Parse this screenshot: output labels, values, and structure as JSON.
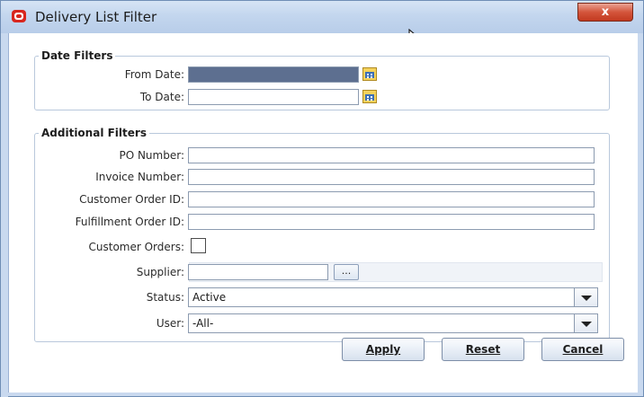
{
  "window": {
    "title": "Delivery List Filter",
    "close_label": "x"
  },
  "date_filters": {
    "legend": "Date Filters",
    "from_label": "From Date:",
    "from_value": "",
    "to_label": "To Date:",
    "to_value": ""
  },
  "additional_filters": {
    "legend": "Additional Filters",
    "po_label": "PO Number:",
    "po_value": "",
    "invoice_label": "Invoice Number:",
    "invoice_value": "",
    "customer_order_id_label": "Customer Order ID:",
    "customer_order_id_value": "",
    "fulfillment_order_id_label": "Fulfillment Order ID:",
    "fulfillment_order_id_value": "",
    "customer_orders_label": "Customer Orders:",
    "customer_orders_checked": false,
    "supplier_label": "Supplier:",
    "supplier_value": "",
    "supplier_button": "...",
    "status_label": "Status:",
    "status_value": "Active",
    "user_label": "User:",
    "user_value": "-All-"
  },
  "buttons": {
    "apply": "Apply",
    "reset": "Reset",
    "cancel": "Cancel"
  },
  "icons": {
    "app": "oracle-icon",
    "calendar": "calendar-icon",
    "dropdown": "chevron-down-icon",
    "cursor": "mouse-cursor-icon"
  },
  "colors": {
    "titlebar": "#c3d6ee",
    "close": "#c94a2e",
    "selection": "#5d6f90"
  }
}
